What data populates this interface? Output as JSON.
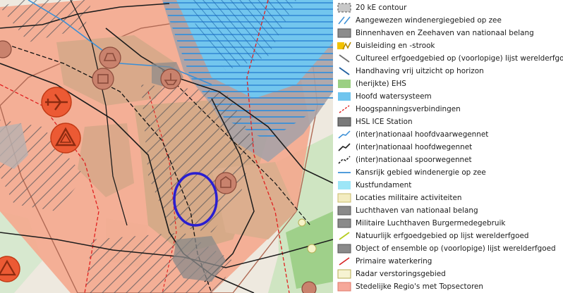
{
  "map": {
    "features": {
      "study_area": "study-area-ellipse",
      "icons": [
        "dam-icon",
        "ship-icon",
        "airplane-icon",
        "triangle-icon",
        "monument-icon"
      ]
    }
  },
  "legend": {
    "items": [
      {
        "label": "20 kE contour",
        "icon": "dashed-grey-box-icon",
        "color": "#c8c8c8"
      },
      {
        "label": "Aangewezen windenergiegebied op zee",
        "icon": "blue-diagonal-lines-icon",
        "color": "#3a8fd6"
      },
      {
        "label": "Binnenhaven en Zeehaven van nationaal belang",
        "icon": "grey-box-icon",
        "color": "#8c8c8c"
      },
      {
        "label": "Buisleiding en -strook",
        "icon": "pipeline-icon",
        "color": "#e5a800"
      },
      {
        "label": "Cultureel erfgoedgebied op (voorlopige) lijst werelderfgoed",
        "icon": "grey-diagonal-line-icon",
        "color": "#6e6e6e"
      },
      {
        "label": "Handhaving vrij uitzicht op horizon",
        "icon": "dark-blue-diagonal-line-icon",
        "color": "#1f5fa0"
      },
      {
        "label": "(herijkte) EHS",
        "icon": "green-box-icon",
        "color": "#9bcf83"
      },
      {
        "label": "Hoofd watersysteem",
        "icon": "light-blue-box-icon",
        "color": "#70c5ee"
      },
      {
        "label": "Hoogspanningsverbindingen",
        "icon": "red-dashed-line-icon",
        "color": "#e02020"
      },
      {
        "label": "HSL ICE Station",
        "icon": "dark-grey-box-icon",
        "color": "#7a7a7a"
      },
      {
        "label": "(inter)nationaal hoofdvaarwegennet",
        "icon": "blue-line-icon",
        "color": "#3a8fd6"
      },
      {
        "label": "(inter)nationaal hoofdwegennet",
        "icon": "black-line-icon",
        "color": "#222222"
      },
      {
        "label": "(inter)nationaal spoorwegennet",
        "icon": "black-dashed-line-icon",
        "color": "#222222"
      },
      {
        "label": "Kansrijk gebied windenergie op zee",
        "icon": "blue-horizontal-lines-icon",
        "color": "#3a8fd6"
      },
      {
        "label": "Kustfundament",
        "icon": "cyan-box-icon",
        "color": "#9de6f7"
      },
      {
        "label": "Locaties militaire activiteiten",
        "icon": "beige-box-icon",
        "color": "#f3ecc0"
      },
      {
        "label": "Luchthaven van nationaal belang",
        "icon": "grey-box-icon",
        "color": "#8a8a8a"
      },
      {
        "label": "Militaire Luchthaven Burgermedegebruik",
        "icon": "grey-box-icon",
        "color": "#8a8a8a"
      },
      {
        "label": "Natuurlijk erfgoedgebied op lijst werelderfgoed",
        "icon": "yellow-green-diagonal-line-icon",
        "color": "#b5cc1e"
      },
      {
        "label": "Object of ensemble op (voorlopige) lijst werelderfgoed",
        "icon": "grey-box-icon",
        "color": "#8a8a8a"
      },
      {
        "label": "Primaire waterkering",
        "icon": "red-diagonal-line-icon",
        "color": "#d62020"
      },
      {
        "label": "Radar verstoringsgebied",
        "icon": "light-yellow-box-icon",
        "color": "#f6f3d2"
      },
      {
        "label": "Stedelijke Regio's met Topsectoren",
        "icon": "salmon-box-icon",
        "color": "#f6a89a"
      }
    ]
  }
}
